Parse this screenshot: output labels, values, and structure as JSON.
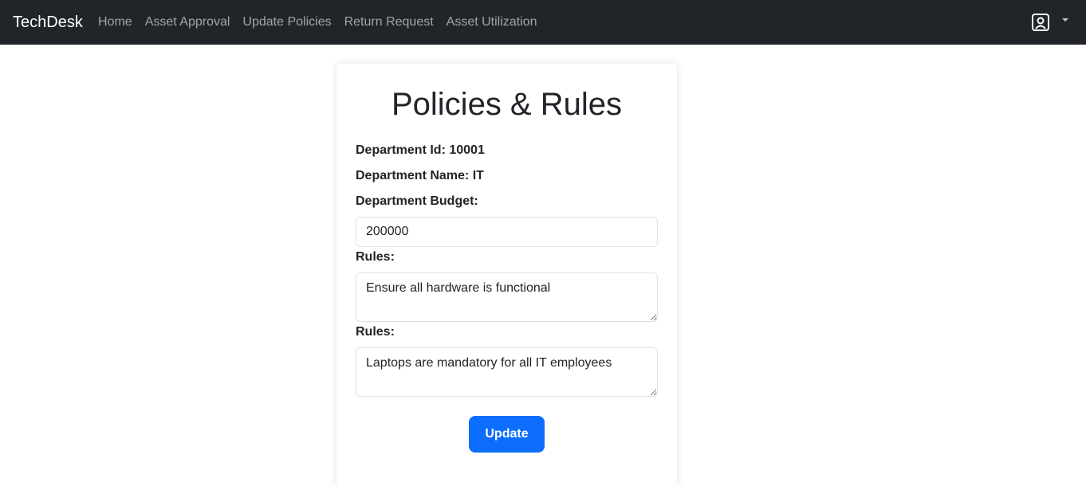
{
  "navbar": {
    "brand": "TechDesk",
    "links": [
      "Home",
      "Asset Approval",
      "Update Policies",
      "Return Request",
      "Asset Utilization"
    ],
    "user_icon": "user-square-icon",
    "caret_icon": "caret-down-icon"
  },
  "form": {
    "title": "Policies & Rules",
    "department_id_label": "Department Id: 10001",
    "department_name_label": "Department Name: IT",
    "budget_label": "Department Budget:",
    "budget_value": "200000",
    "rules_label_1": "Rules:",
    "rule_1": "Ensure all hardware is functional",
    "rules_label_2": "Rules:",
    "rule_2": "Laptops are mandatory for all IT employees",
    "update_button": "Update"
  },
  "colors": {
    "navbar_bg": "#212529",
    "primary": "#0d6efd"
  }
}
